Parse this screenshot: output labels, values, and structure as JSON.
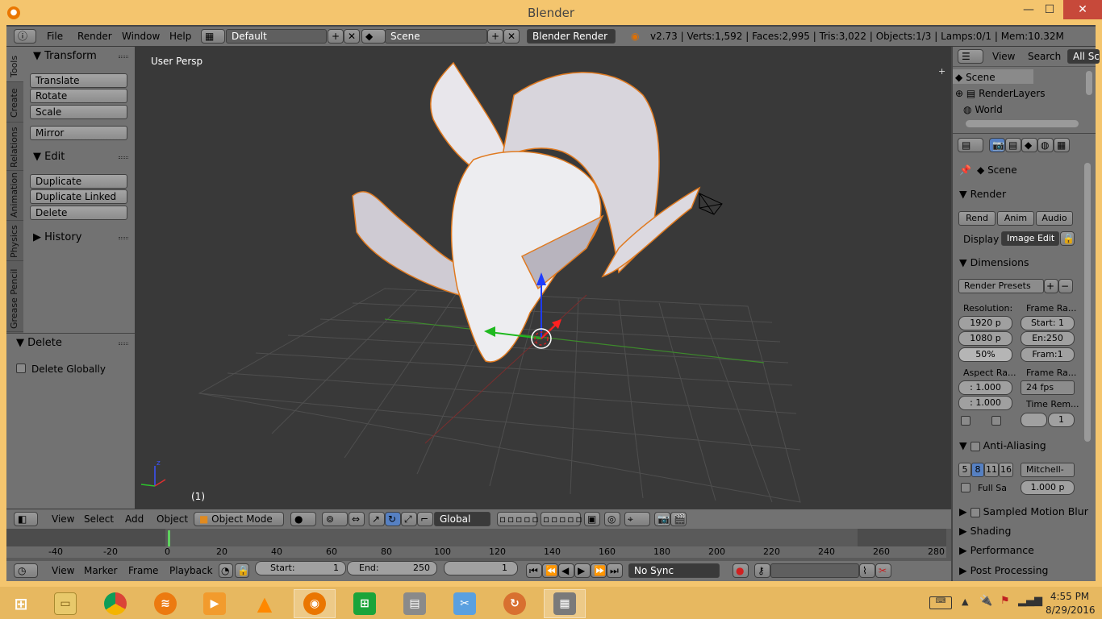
{
  "window": {
    "title": "Blender",
    "minimize": "—",
    "maximize": "☐",
    "close": "✕"
  },
  "info_header": {
    "menus": [
      "File",
      "Render",
      "Window",
      "Help"
    ],
    "layout": "Default",
    "scene": "Scene",
    "engine": "Blender Render",
    "stats": "v2.73 | Verts:1,592 | Faces:2,995 | Tris:3,022 | Objects:1/3 | Lamps:0/1 | Mem:10.32M"
  },
  "tool_tabs": [
    "Tools",
    "Create",
    "Relations",
    "Animation",
    "Physics",
    "Grease Pencil"
  ],
  "tool_shelf": {
    "transform_title": "Transform",
    "transform_buttons": [
      "Translate",
      "Rotate",
      "Scale"
    ],
    "mirror": "Mirror",
    "edit_title": "Edit",
    "edit_buttons": [
      "Duplicate",
      "Duplicate Linked",
      "Delete"
    ],
    "history_title": "History"
  },
  "operator_panel": {
    "title": "Delete",
    "option": "Delete Globally"
  },
  "viewport": {
    "view_name": "User Persp",
    "frame_label": "(1)"
  },
  "view3d_header": {
    "menus": [
      "View",
      "Select",
      "Add",
      "Object"
    ],
    "mode": "Object Mode",
    "orientation": "Global"
  },
  "timeline": {
    "ruler": [
      "-40",
      "-20",
      "0",
      "20",
      "40",
      "60",
      "80",
      "100",
      "120",
      "140",
      "160",
      "180",
      "200",
      "220",
      "240",
      "260",
      "280"
    ],
    "menus": [
      "View",
      "Marker",
      "Frame",
      "Playback"
    ],
    "start_label": "Start:",
    "start": "1",
    "end_label": "End:",
    "end": "250",
    "current": "1",
    "sync": "No Sync"
  },
  "outliner": {
    "menus": [
      "View",
      "Search"
    ],
    "filter": "All Sc",
    "items": [
      "Scene",
      "RenderLayers",
      "World"
    ]
  },
  "properties": {
    "context": "Scene",
    "render_title": "Render",
    "render_buttons": [
      "Rend",
      "Anim",
      "Audio"
    ],
    "display_label": "Display",
    "display_value": "Image Edit",
    "dimensions_title": "Dimensions",
    "render_presets": "Render Presets",
    "resolution_label": "Resolution:",
    "res_x": "1920 p",
    "res_y": "1080 p",
    "res_pct": "50%",
    "frame_range_label": "Frame Ra...",
    "start": "Start: 1",
    "end": "En:250",
    "step": "Fram:1",
    "aspect_label": "Aspect Ra...",
    "aspect_x": ": 1.000",
    "aspect_y": ": 1.000",
    "frame_rate_label": "Frame Ra...",
    "fps": "24 fps",
    "time_remap_label": "Time Rem...",
    "time_remap_val": "1",
    "aa_title": "Anti-Aliasing",
    "aa_samples": [
      "5",
      "8",
      "11",
      "16"
    ],
    "aa_filter": "Mitchell-",
    "full_sample": "Full Sa",
    "filter_size": "1.000 p",
    "collapsed": [
      "Sampled Motion Blur",
      "Shading",
      "Performance",
      "Post Processing"
    ]
  },
  "taskbar": {
    "time": "4:55 PM",
    "date": "8/29/2016"
  }
}
